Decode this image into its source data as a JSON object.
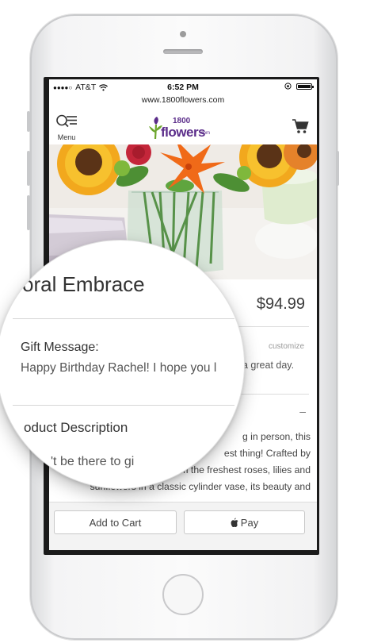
{
  "status_bar": {
    "carrier": "AT&T",
    "signal_dots": "●●●●○",
    "time": "6:52 PM"
  },
  "browser": {
    "url": "www.1800flowers.com"
  },
  "nav": {
    "menu_label": "Menu",
    "logo_number": "1800",
    "logo_name": "flowers",
    "logo_suffix": ".com"
  },
  "product": {
    "title": "oral Embrace",
    "price": "$94.99",
    "gift_message_label": "Gift Message:",
    "gift_message_text": "Happy Birthday Rachel! I hope you l",
    "gift_message_tail": "a great day.",
    "customize_label": "customize",
    "collapse_symbol": "–",
    "description_heading": "oduct Description",
    "description_text": "g in person, this\nest thing! Crafted by\nour experts from the freshest roses, lilies and\nsunflowers in a classic cylinder vase, its beauty and",
    "magnified_bottom": "'t be there to gi"
  },
  "footer": {
    "add_to_cart": "Add to Cart",
    "apple_pay": "Pay"
  },
  "colors": {
    "brand_purple": "#5b2d8a",
    "brand_green": "#6ca52c"
  }
}
